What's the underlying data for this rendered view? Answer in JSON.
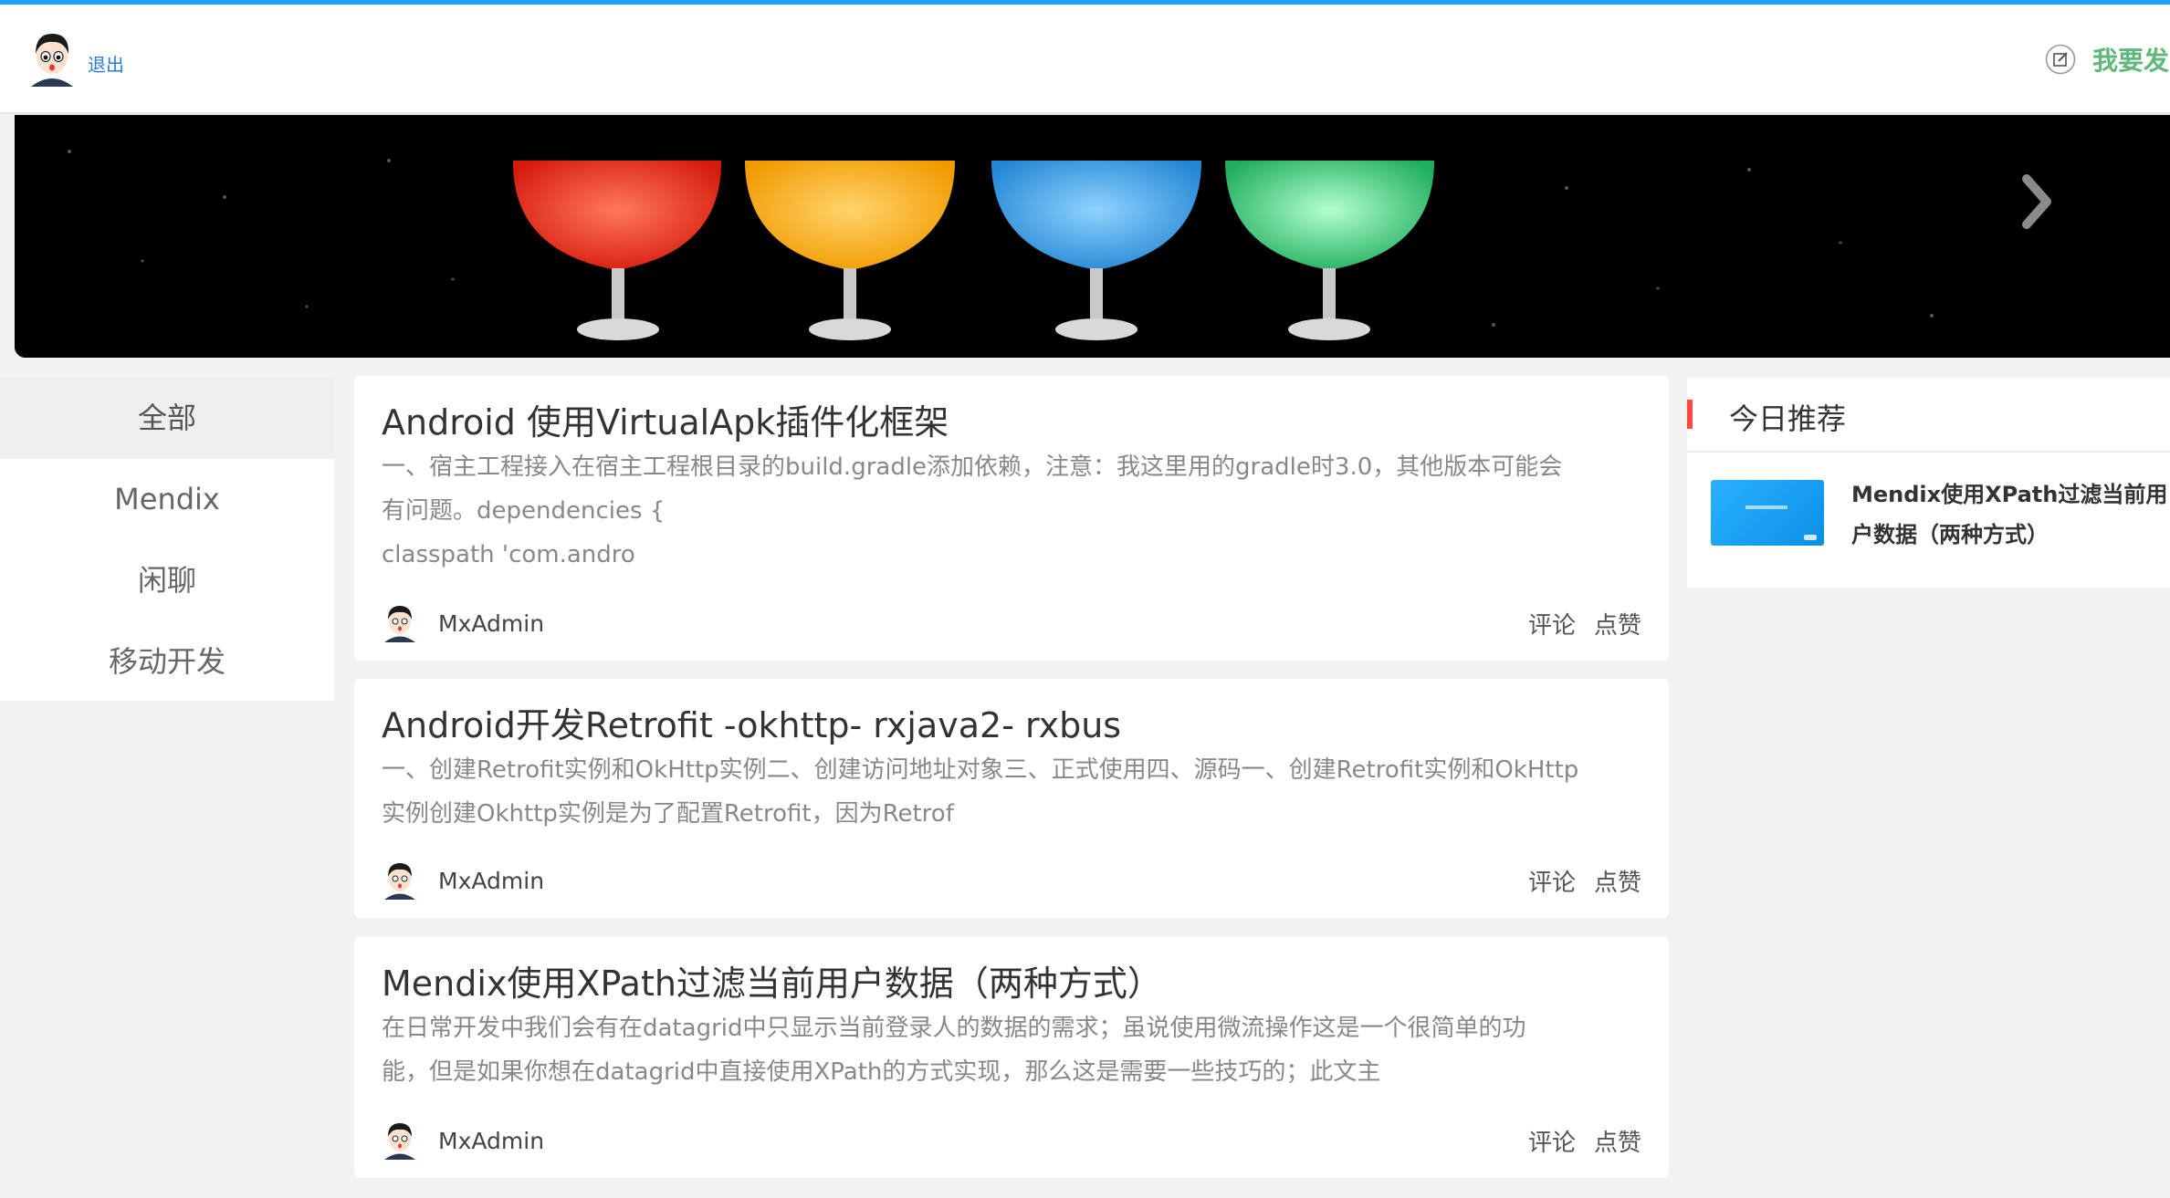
{
  "header": {
    "logout_label": "退出",
    "post_label": "我要发"
  },
  "categories": [
    {
      "label": "全部",
      "active": true
    },
    {
      "label": "Mendix",
      "active": false
    },
    {
      "label": "闲聊",
      "active": false
    },
    {
      "label": "移动开发",
      "active": false
    }
  ],
  "articles": [
    {
      "title": "Android 使用VirtualApk插件化框架",
      "excerpt": [
        "一、宿主工程接入在宿主工程根目录的build.gradle添加依赖，注意：我这里用的gradle时3.0，其他版本可能会",
        "有问题。dependencies {",
        "classpath 'com.andro"
      ],
      "author": "MxAdmin",
      "comment_label": "评论",
      "like_label": "点赞"
    },
    {
      "title": "Android开发Retrofit -okhttp- rxjava2- rxbus",
      "excerpt": [
        " 一、创建Retrofit实例和OkHttp实例二、创建访问地址对象三、正式使用四、源码一、创建Retrofit实例和OkHttp",
        "实例创建Okhttp实例是为了配置Retrofit，因为Retrof"
      ],
      "author": "MxAdmin",
      "comment_label": "评论",
      "like_label": "点赞"
    },
    {
      "title": "Mendix使用XPath过滤当前用户数据（两种方式）",
      "excerpt": [
        "在日常开发中我们会有在datagrid中只显示当前登录人的数据的需求；虽说使用微流操作这是一个很简单的功",
        "能，但是如果你想在datagrid中直接使用XPath的方式实现，那么这是需要一些技巧的；此文主"
      ],
      "author": "MxAdmin",
      "comment_label": "评论",
      "like_label": "点赞"
    }
  ],
  "recommend": {
    "title": "今日推荐",
    "item": {
      "line1": "Mendix使用XPath过滤当前用",
      "line2": "户数据（两种方式）"
    }
  },
  "colors": {
    "accent": "#1e9fff",
    "post_green": "#5fb878",
    "recommend_bar": "#ff4b3e",
    "drink_colors": [
      "#ff2a1a",
      "#ffb21c",
      "#3aa6ea",
      "#3fce7d"
    ]
  }
}
